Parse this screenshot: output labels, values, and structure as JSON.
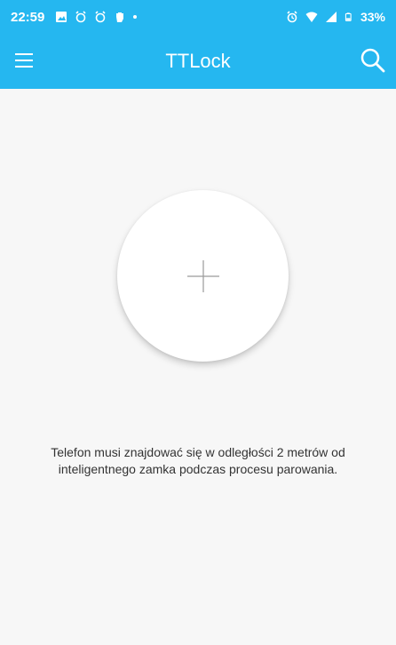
{
  "status_bar": {
    "time": "22:59",
    "battery": "33%",
    "icons_left": [
      "image-icon",
      "alarm-app-icon",
      "alarm-app-icon",
      "hand-icon",
      "dot-icon"
    ],
    "icons_right": [
      "alarm-icon",
      "wifi-icon",
      "signal-icon",
      "battery-icon"
    ]
  },
  "app_bar": {
    "title": "TTLock",
    "menu_icon": "menu-icon",
    "search_icon": "search-icon"
  },
  "main": {
    "add_button_icon": "plus-icon",
    "hint": "Telefon musi znajdować się w odległości 2 metrów od inteligentnego zamka podczas procesu parowania."
  },
  "colors": {
    "accent": "#25b7f0",
    "background": "#f7f7f7",
    "text": "#333333"
  }
}
